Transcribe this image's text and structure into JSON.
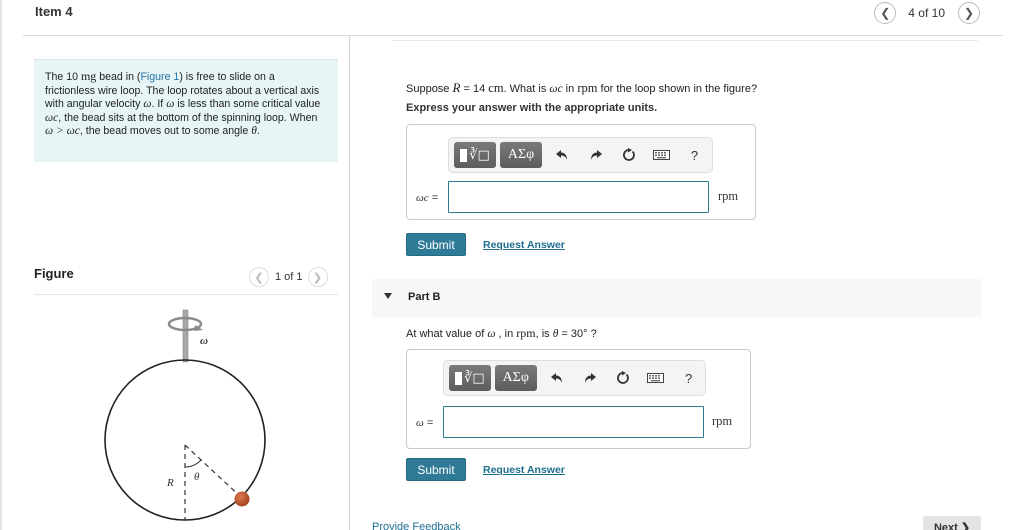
{
  "header": {
    "item_title": "Item 4",
    "pager_text": "4 of 10",
    "prev_icon": "chevron-left-icon",
    "next_icon": "chevron-right-icon"
  },
  "intro": {
    "t1": "The 10 ",
    "mass_unit": "mg",
    "t2": " bead in (",
    "figure_link": "Figure 1",
    "t3": ") is free to slide on a frictionless wire loop. The loop rotates about a vertical axis with angular velocity ",
    "omega": "ω",
    "t4": ". If ",
    "t5": " is less than some critical value ",
    "omega_c": "ωc",
    "t6": ", the bead sits at the bottom of the spinning loop. When ",
    "ineq": "ω > ωc",
    "t7": ", the bead moves out to some angle ",
    "theta": "θ",
    "t8": "."
  },
  "figure": {
    "title": "Figure",
    "pager_text": "1 of 1",
    "labels": {
      "omega": "ω",
      "radius": "R",
      "theta": "θ"
    },
    "colors": {
      "bead": "#b5532d",
      "loop": "#222222",
      "axle": "#9a9a9a"
    }
  },
  "part_a": {
    "q1": "Suppose ",
    "q_var": "R",
    "q2": " = 14 ",
    "q_unit": "cm",
    "q3": ". What is ",
    "q_omega": "ωc",
    "q4": " in ",
    "q_rpm": "rpm",
    "q5": " for the loop shown in the figure?",
    "instruction": "Express your answer with the appropriate units.",
    "toolbar": {
      "template_icon": "radical-template-icon",
      "greek_label": "ΑΣφ",
      "undo_icon": "undo-icon",
      "redo_icon": "redo-icon",
      "reset_icon": "reset-icon",
      "keyboard_icon": "keyboard-icon",
      "help_label": "?"
    },
    "answer_label": "ωc",
    "answer_eq": " =",
    "answer_value": "",
    "unit": "rpm",
    "submit_label": "Submit",
    "request_label": "Request Answer"
  },
  "part_b": {
    "title": "Part B",
    "q1": "At what value of ",
    "q_omega": "ω",
    "q2": " , in ",
    "q_rpm": "rpm",
    "q3": ", is ",
    "q_theta": "θ",
    "q4": " = 30° ?",
    "toolbar": {
      "greek_label": "ΑΣφ",
      "help_label": "?"
    },
    "answer_label": "ω",
    "answer_eq": " =",
    "answer_value": "",
    "unit": "rpm",
    "submit_label": "Submit",
    "request_label": "Request Answer"
  },
  "footer": {
    "feedback_label": "Provide Feedback",
    "next_label": "Next ❯"
  },
  "colors": {
    "accent": "#2f7a96",
    "link": "#1f6e90",
    "intro_bg": "#e8f5f6"
  }
}
